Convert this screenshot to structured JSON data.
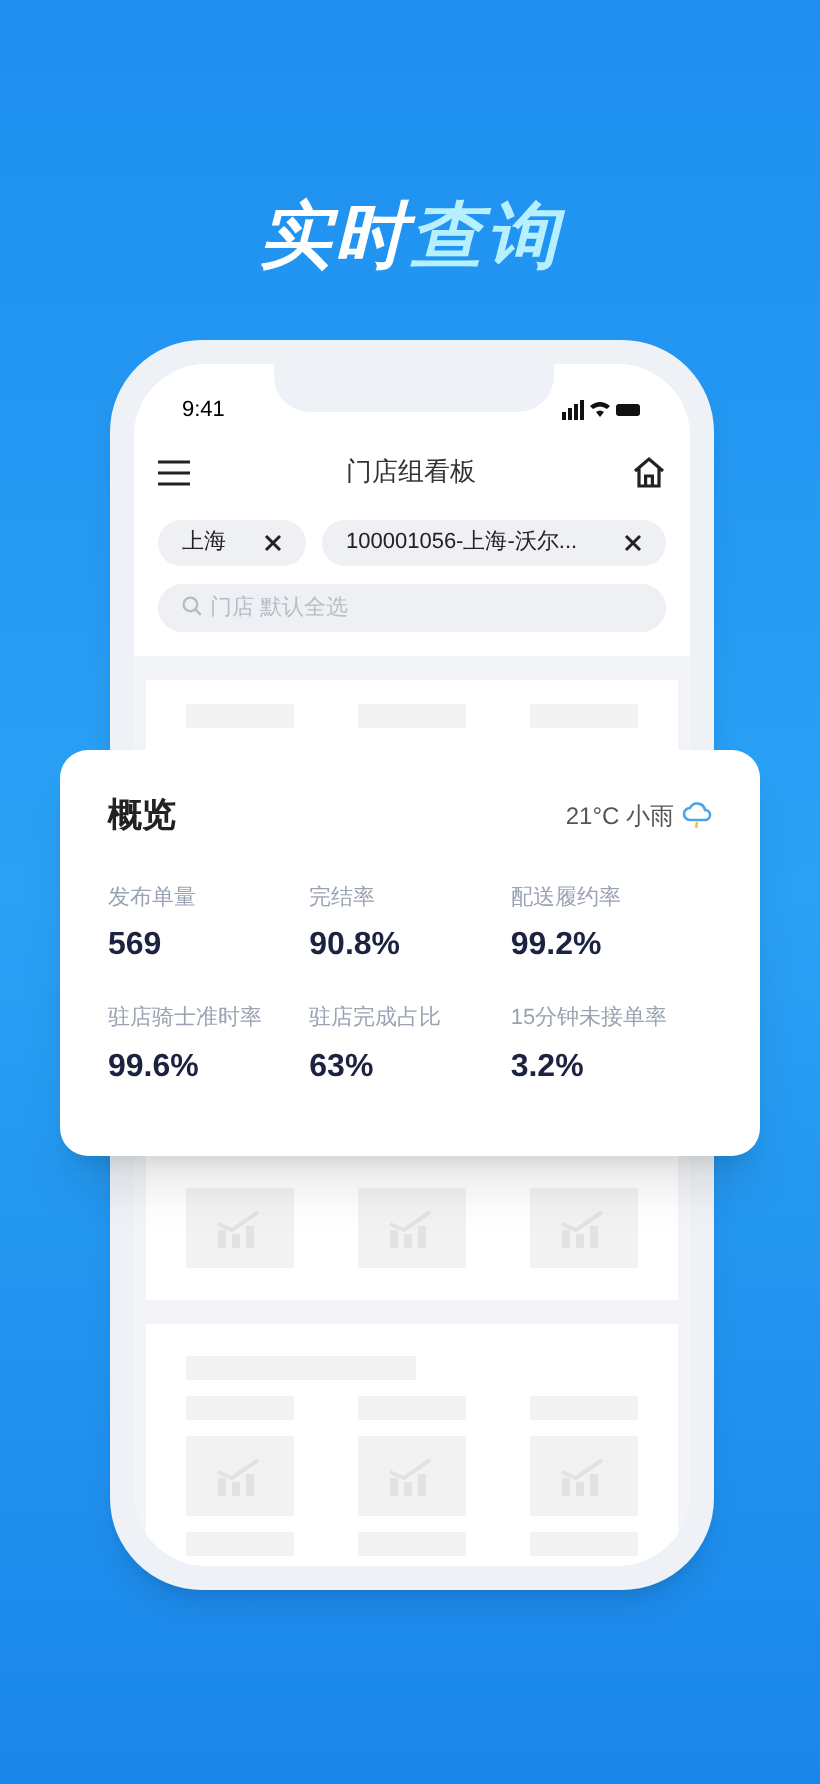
{
  "headline": [
    {
      "text": "实时",
      "kind": "plain"
    },
    {
      "text": "查询",
      "kind": "accent"
    }
  ],
  "status_bar": {
    "time": "9:41"
  },
  "header": {
    "title": "门店组看板"
  },
  "filters": [
    {
      "label": "上海"
    },
    {
      "label": "100001056-上海-沃尔..."
    }
  ],
  "search": {
    "placeholder": "门店 默认全选"
  },
  "overview": {
    "title": "概览",
    "weather": "21°C 小雨",
    "metrics": [
      {
        "label": "发布单量",
        "value": "569"
      },
      {
        "label": "完结率",
        "value": "90.8%"
      },
      {
        "label": "配送履约率",
        "value": "99.2%"
      },
      {
        "label": "驻店骑士准时率",
        "value": "99.6%"
      },
      {
        "label": "驻店完成占比",
        "value": "63%"
      },
      {
        "label": "15分钟未接单率",
        "value": "3.2%"
      }
    ]
  }
}
